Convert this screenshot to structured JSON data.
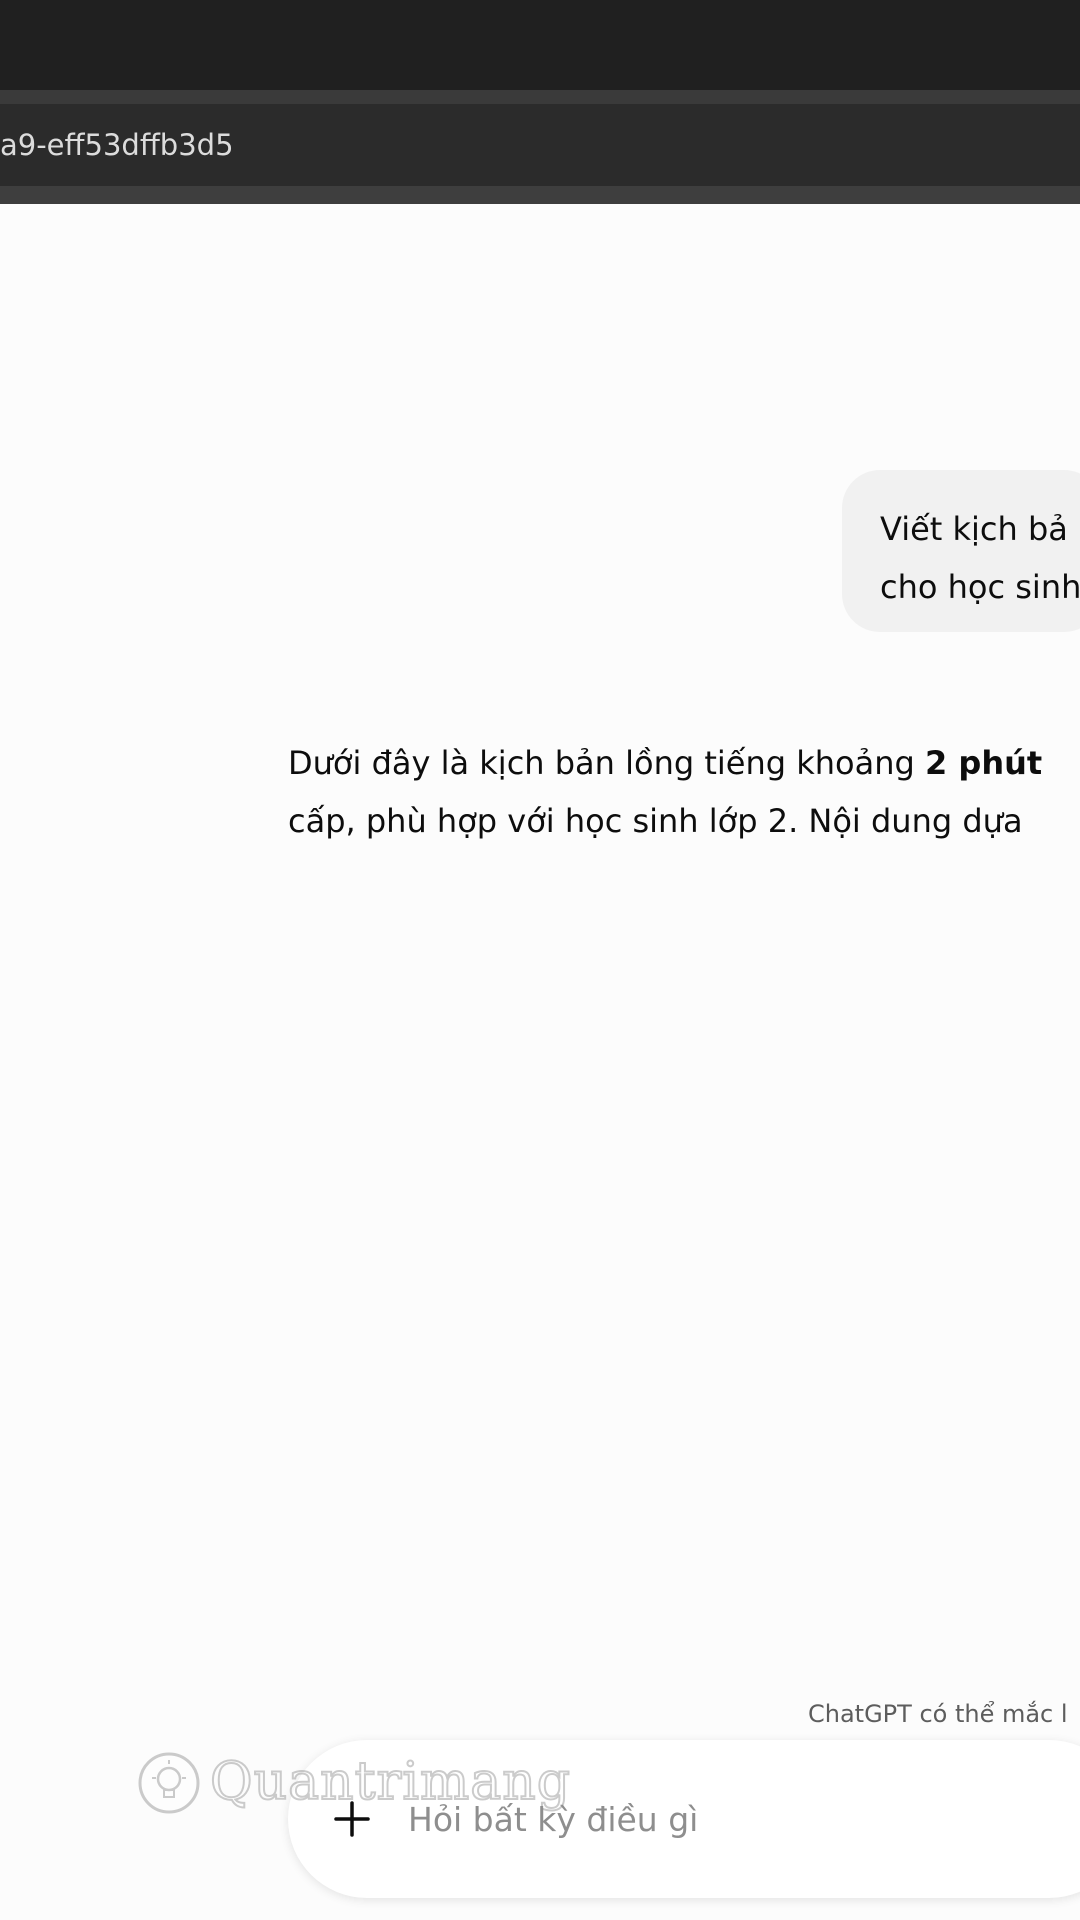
{
  "browser": {
    "url_fragment": "a9-eff53dffb3d5"
  },
  "conversation": {
    "user_message": {
      "line1": "Viết kịch bả",
      "line2": "cho học sinh"
    },
    "assistant_message": {
      "line1_before": "Dưới đây là kịch bản lồng tiếng khoảng ",
      "line1_bold": "2 phút",
      "line2": "cấp, phù hợp với học sinh lớp 2. Nội dung dựa"
    }
  },
  "footer": {
    "disclaimer": "ChatGPT có thể mắc l"
  },
  "composer": {
    "placeholder": "Hỏi bất kỳ điều gì",
    "add_icon": "plus-icon"
  },
  "watermark": {
    "text": "Quantrimang"
  }
}
